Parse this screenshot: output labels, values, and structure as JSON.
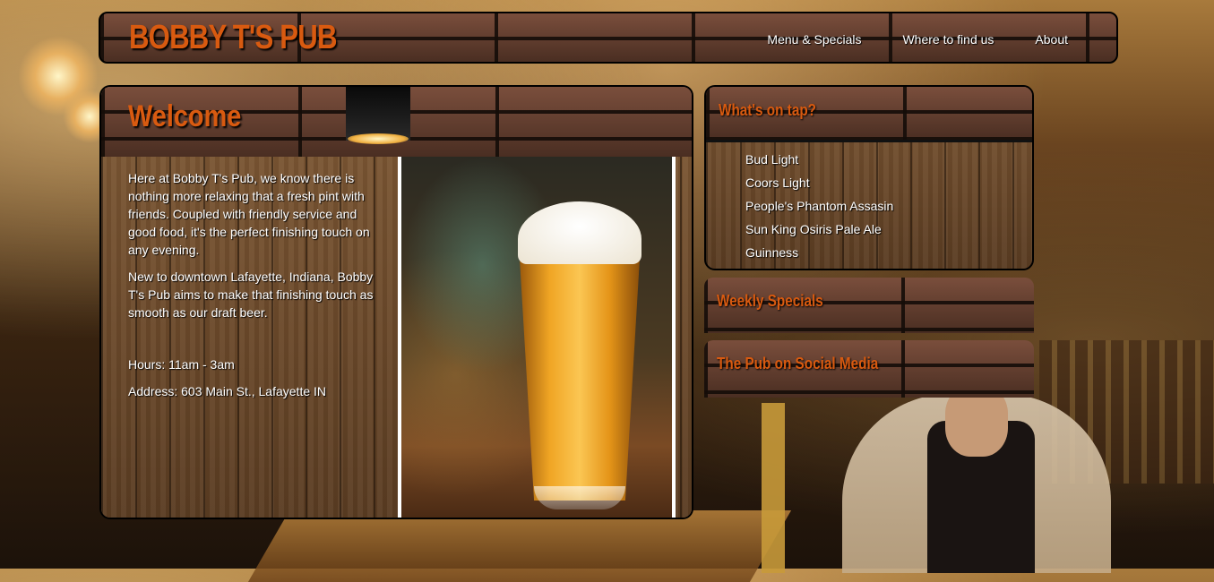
{
  "header": {
    "site_title": "BOBBY T'S PUB",
    "nav": [
      "Menu & Specials",
      "Where to find us",
      "About"
    ]
  },
  "welcome": {
    "heading": "Welcome",
    "paragraph1": "Here at Bobby T's Pub, we know there is nothing more relaxing that a fresh pint with friends. Coupled with friendly service and good food, it's the perfect finishing touch on any evening.",
    "paragraph2": "New to downtown Lafayette, Indiana, Bobby T's Pub aims to make that finishing touch as smooth as our draft beer.",
    "hours": "Hours: 11am - 3am",
    "address": "Address: 603 Main St., Lafayette IN"
  },
  "tap": {
    "heading": "What's on tap?",
    "items": [
      "Bud Light",
      "Coors Light",
      "People's Phantom Assasin",
      "Sun King Osiris Pale Ale",
      "Guinness"
    ]
  },
  "specials": {
    "heading": "Weekly Specials"
  },
  "social": {
    "heading": "The Pub on Social Media"
  },
  "colors": {
    "accent": "#d85a10",
    "text": "#ffffff"
  }
}
